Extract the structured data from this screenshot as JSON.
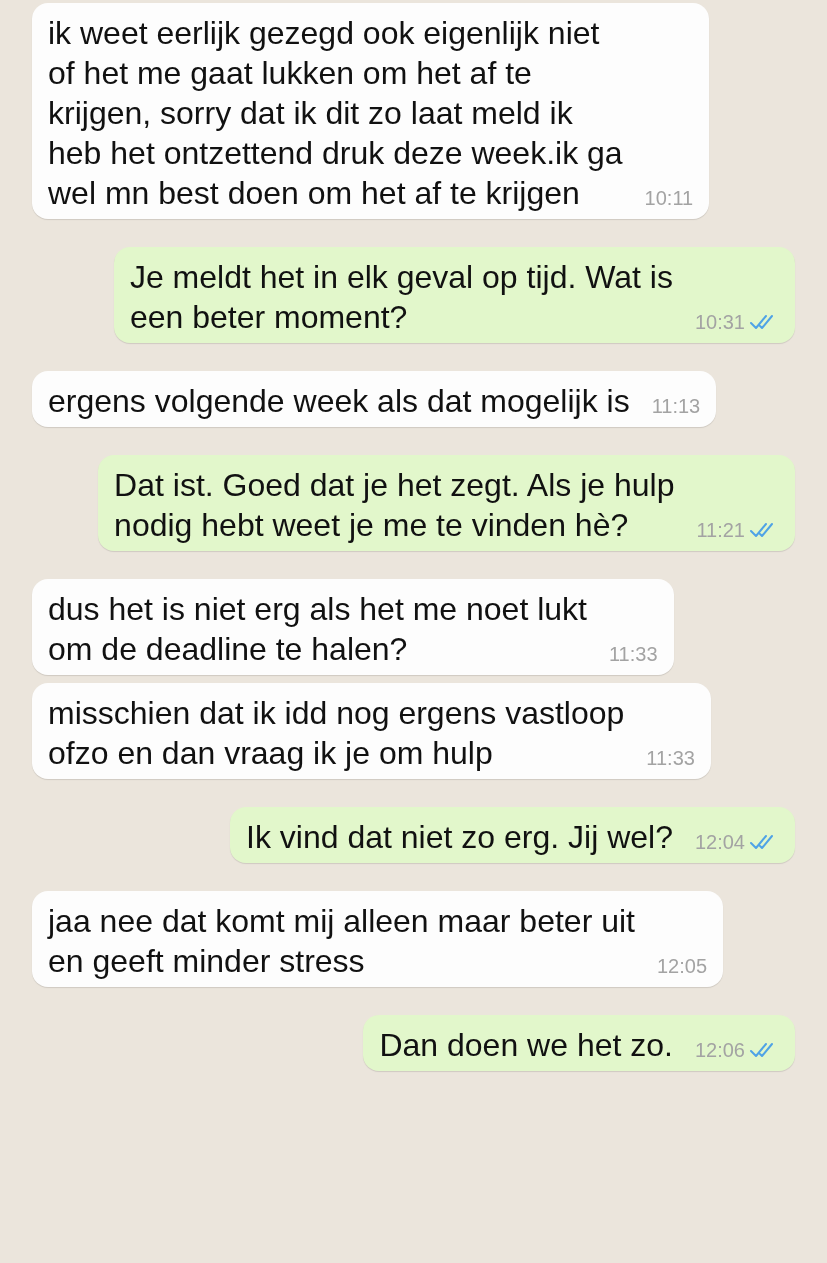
{
  "messages": [
    {
      "kind": "incoming",
      "text": "ik weet eerlijk gezegd ook eigenlijk niet\nof het me gaat lukken om het af te\nkrijgen, sorry dat ik dit zo laat meld ik\nheb het ontzettend druk deze week.ik ga\nwel mn best doen om het af te krijgen",
      "time": "10:11"
    },
    {
      "kind": "outgoing",
      "text": "Je meldt het in elk geval op tijd. Wat is\neen beter moment?",
      "time": "10:31",
      "read": true
    },
    {
      "kind": "incoming",
      "text": "ergens volgende week als dat mogelijk is",
      "time": "11:13"
    },
    {
      "kind": "outgoing",
      "text": "Dat ist. Goed dat je het zegt. Als je hulp\nnodig hebt weet je me te vinden hè?",
      "time": "11:21",
      "read": true
    },
    {
      "kind": "incoming",
      "text": "dus het is niet erg als het me noet lukt\nom de deadline te halen?",
      "time": "11:33"
    },
    {
      "kind": "incoming",
      "text": "misschien dat ik idd nog ergens vastloop\nofzo en dan vraag ik je om hulp",
      "time": "11:33"
    },
    {
      "kind": "outgoing",
      "text": "Ik vind dat niet zo erg. Jij wel?",
      "time": "12:04",
      "read": true
    },
    {
      "kind": "incoming",
      "text": "jaa nee dat komt mij alleen maar beter uit\nen geeft minder stress",
      "time": "12:05"
    },
    {
      "kind": "outgoing",
      "text": "Dan doen we het zo.",
      "time": "12:06",
      "read": true
    }
  ]
}
